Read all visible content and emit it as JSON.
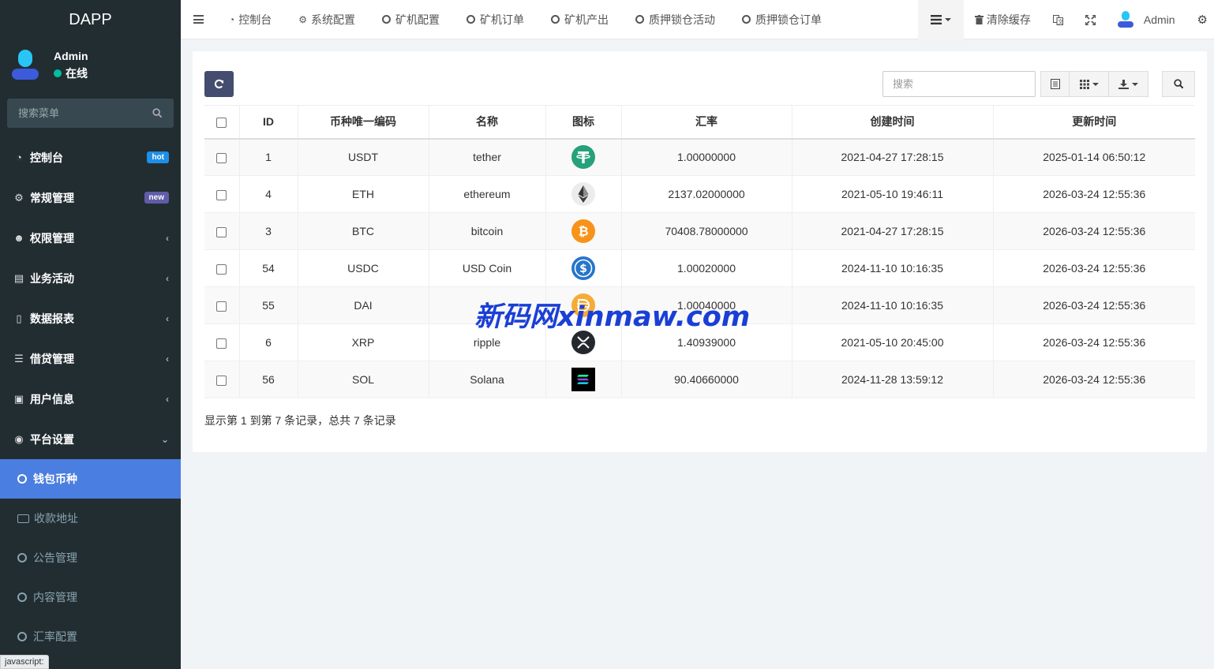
{
  "brand": "DAPP",
  "user": {
    "name": "Admin",
    "status": "在线"
  },
  "sidebar_search": {
    "placeholder": "搜索菜单"
  },
  "menu": [
    {
      "label": "控制台",
      "icon": "dashboard-icon",
      "badge": "hot"
    },
    {
      "label": "常规管理",
      "icon": "cogs-icon",
      "badge": "new"
    },
    {
      "label": "权限管理",
      "icon": "users-icon"
    },
    {
      "label": "业务活动",
      "icon": "list-alt-icon"
    },
    {
      "label": "数据报表",
      "icon": "file-icon"
    },
    {
      "label": "借贷管理",
      "icon": "list-icon"
    },
    {
      "label": "用户信息",
      "icon": "contact-icon"
    },
    {
      "label": "平台设置",
      "icon": "dot-circle-icon"
    }
  ],
  "submenu": [
    {
      "label": "钱包币种",
      "active": true
    },
    {
      "label": "收款地址"
    },
    {
      "label": "公告管理"
    },
    {
      "label": "内容管理"
    },
    {
      "label": "汇率配置"
    }
  ],
  "topnav": {
    "tabs": [
      "控制台",
      "系统配置",
      "矿机配置",
      "矿机订单",
      "矿机产出",
      "质押锁仓活动",
      "质押锁仓订单"
    ],
    "clear_cache": "清除缓存",
    "admin": "Admin"
  },
  "toolbar": {
    "search_placeholder": "搜索"
  },
  "table": {
    "headers": [
      "ID",
      "币种唯一编码",
      "名称",
      "图标",
      "汇率",
      "创建时间",
      "更新时间"
    ],
    "rows": [
      {
        "id": "1",
        "code": "USDT",
        "name": "tether",
        "icon": "usdt-icon",
        "rate": "1.00000000",
        "created": "2021-04-27 17:28:15",
        "updated": "2025-01-14 06:50:12"
      },
      {
        "id": "4",
        "code": "ETH",
        "name": "ethereum",
        "icon": "eth-icon",
        "rate": "2137.02000000",
        "created": "2021-05-10 19:46:11",
        "updated": "2026-03-24 12:55:36"
      },
      {
        "id": "3",
        "code": "BTC",
        "name": "bitcoin",
        "icon": "btc-icon",
        "rate": "70408.78000000",
        "created": "2021-04-27 17:28:15",
        "updated": "2026-03-24 12:55:36"
      },
      {
        "id": "54",
        "code": "USDC",
        "name": "USD Coin",
        "icon": "usdc-icon",
        "rate": "1.00020000",
        "created": "2024-11-10 10:16:35",
        "updated": "2026-03-24 12:55:36"
      },
      {
        "id": "55",
        "code": "DAI",
        "name": "",
        "icon": "dai-icon",
        "rate": "1.00040000",
        "created": "2024-11-10 10:16:35",
        "updated": "2026-03-24 12:55:36"
      },
      {
        "id": "6",
        "code": "XRP",
        "name": "ripple",
        "icon": "xrp-icon",
        "rate": "1.40939000",
        "created": "2021-05-10 20:45:00",
        "updated": "2026-03-24 12:55:36"
      },
      {
        "id": "56",
        "code": "SOL",
        "name": "Solana",
        "icon": "sol-icon",
        "rate": "90.40660000",
        "created": "2024-11-28 13:59:12",
        "updated": "2026-03-24 12:55:36"
      }
    ]
  },
  "pagination_info": "显示第 1 到第 7 条记录，总共 7 条记录",
  "watermark": "新码网xinmaw.com",
  "status_bar": "javascript:",
  "colors": {
    "sidebar": "#222d32",
    "active": "#4a7ee0",
    "primary_btn": "#444d6f",
    "watermark": "#1a3fd6"
  }
}
